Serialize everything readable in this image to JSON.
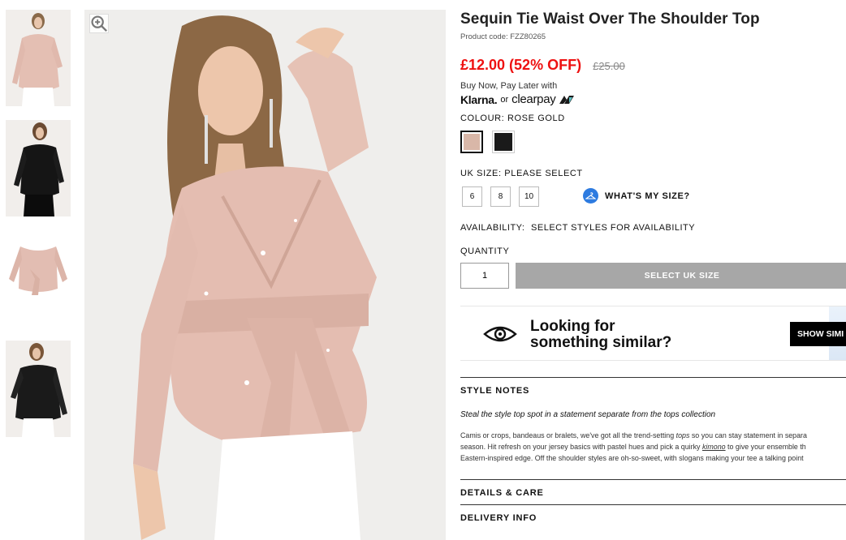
{
  "product": {
    "title": "Sequin Tie Waist Over The Shoulder Top",
    "code": "Product code: FZZ80265",
    "price_now": "£12.00 (52% OFF)",
    "price_was": "£25.00"
  },
  "bnpl": {
    "label": "Buy Now, Pay Later with",
    "klarna": "Klarna.",
    "or": "or",
    "clearpay": "clearpay"
  },
  "colour": {
    "label": "COLOUR: ROSE GOLD",
    "options": [
      {
        "name": "rose-gold",
        "color": "#d9b7a8"
      },
      {
        "name": "black",
        "color": "#1a1a1a"
      }
    ]
  },
  "size": {
    "label": "UK SIZE: PLEASE SELECT",
    "options": [
      "6",
      "8",
      "10"
    ],
    "fit_guide": "WHAT'S MY SIZE?"
  },
  "availability": {
    "label": "AVAILABILITY:",
    "value": "SELECT STYLES FOR AVAILABILITY"
  },
  "quantity": {
    "label": "QUANTITY",
    "value": "1",
    "button": "SELECT UK SIZE"
  },
  "similar": {
    "line1": "Looking for",
    "line2": "something similar?",
    "button": "SHOW SIMI"
  },
  "style_notes": {
    "title": "STYLE NOTES",
    "lede": "Steal the style top spot in a statement separate from the tops collection",
    "line1_a": "Camis or crops, bandeaus or bralets, we've got all the trend-setting ",
    "line1_link": "tops",
    "line1_b": " so you can stay statement in separa",
    "line2_a": "season. Hit refresh on your jersey basics with pastel hues and pick a quirky ",
    "line2_link": "kimono",
    "line2_b": " to give your ensemble th",
    "line3": "Eastern-inspired edge. Off the shoulder styles are oh-so-sweet, with slogans making your tee a talking point"
  },
  "details": {
    "title": "DETAILS & CARE"
  },
  "delivery": {
    "title": "DELIVERY INFO"
  },
  "colors": {
    "price": "#e11111",
    "button_disabled": "#a7a7a7",
    "fit_icon": "#2d7be0"
  }
}
